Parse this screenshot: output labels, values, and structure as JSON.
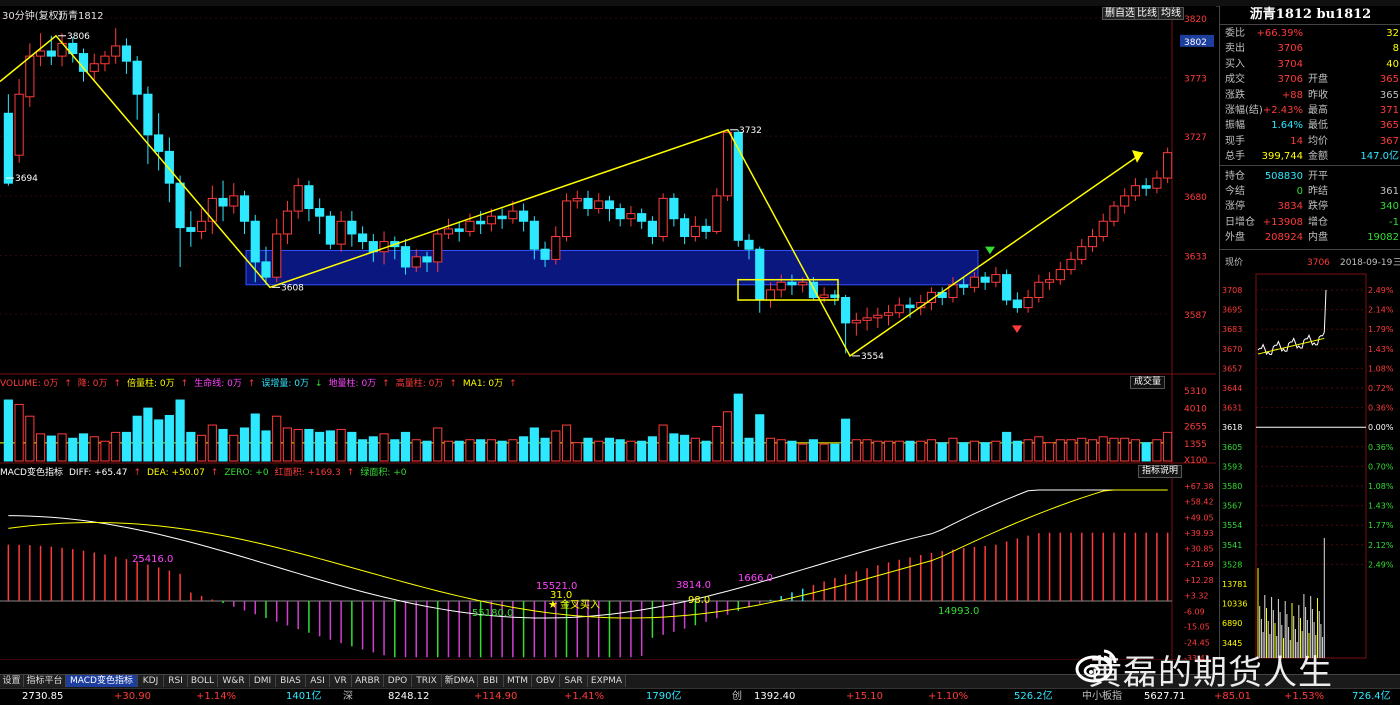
{
  "header": {
    "period": "30分钟(复权)",
    "symbol": "沥青1812",
    "buttons": [
      "删自选",
      "比线",
      "均线"
    ]
  },
  "chart_data": {
    "type": "candlestick",
    "price_axis_labels": [
      "3820",
      "3773",
      "3727",
      "3680",
      "3633",
      "3587"
    ],
    "current_price_tag": "3802",
    "candles": [
      [
        3745,
        3690,
        3760,
        3688
      ],
      [
        3712,
        3760,
        3772,
        3706
      ],
      [
        3758,
        3790,
        3800,
        3750
      ],
      [
        3790,
        3794,
        3808,
        3782
      ],
      [
        3794,
        3790,
        3806,
        3783
      ],
      [
        3790,
        3800,
        3808,
        3782
      ],
      [
        3800,
        3792,
        3805,
        3785
      ],
      [
        3792,
        3778,
        3796,
        3770
      ],
      [
        3778,
        3784,
        3792,
        3770
      ],
      [
        3784,
        3790,
        3794,
        3778
      ],
      [
        3790,
        3798,
        3812,
        3784
      ],
      [
        3798,
        3786,
        3804,
        3776
      ],
      [
        3786,
        3760,
        3790,
        3740
      ],
      [
        3760,
        3728,
        3766,
        3705
      ],
      [
        3728,
        3715,
        3745,
        3700
      ],
      [
        3715,
        3690,
        3726,
        3675
      ],
      [
        3690,
        3655,
        3696,
        3624
      ],
      [
        3655,
        3652,
        3668,
        3640
      ],
      [
        3652,
        3660,
        3670,
        3646
      ],
      [
        3660,
        3678,
        3688,
        3650
      ],
      [
        3678,
        3672,
        3692,
        3660
      ],
      [
        3672,
        3680,
        3690,
        3666
      ],
      [
        3680,
        3660,
        3684,
        3650
      ],
      [
        3660,
        3628,
        3665,
        3612
      ],
      [
        3628,
        3616,
        3640,
        3610
      ],
      [
        3616,
        3650,
        3662,
        3612
      ],
      [
        3650,
        3668,
        3676,
        3642
      ],
      [
        3668,
        3688,
        3694,
        3662
      ],
      [
        3688,
        3670,
        3692,
        3660
      ],
      [
        3670,
        3664,
        3678,
        3650
      ],
      [
        3664,
        3642,
        3668,
        3638
      ],
      [
        3642,
        3660,
        3668,
        3636
      ],
      [
        3660,
        3650,
        3668,
        3640
      ],
      [
        3650,
        3644,
        3656,
        3638
      ],
      [
        3644,
        3636,
        3650,
        3628
      ],
      [
        3636,
        3644,
        3652,
        3626
      ],
      [
        3644,
        3640,
        3648,
        3630
      ],
      [
        3640,
        3624,
        3646,
        3618
      ],
      [
        3624,
        3632,
        3638,
        3620
      ],
      [
        3632,
        3628,
        3636,
        3620
      ],
      [
        3628,
        3650,
        3654,
        3620
      ],
      [
        3650,
        3654,
        3662,
        3646
      ],
      [
        3654,
        3652,
        3660,
        3644
      ],
      [
        3652,
        3660,
        3666,
        3648
      ],
      [
        3660,
        3658,
        3668,
        3650
      ],
      [
        3658,
        3664,
        3670,
        3652
      ],
      [
        3664,
        3662,
        3670,
        3654
      ],
      [
        3662,
        3668,
        3676,
        3658
      ],
      [
        3668,
        3660,
        3674,
        3652
      ],
      [
        3660,
        3638,
        3664,
        3630
      ],
      [
        3638,
        3630,
        3644,
        3624
      ],
      [
        3630,
        3648,
        3656,
        3626
      ],
      [
        3648,
        3676,
        3682,
        3644
      ],
      [
        3676,
        3678,
        3684,
        3670
      ],
      [
        3678,
        3670,
        3684,
        3664
      ],
      [
        3670,
        3676,
        3682,
        3666
      ],
      [
        3676,
        3670,
        3680,
        3660
      ],
      [
        3670,
        3662,
        3674,
        3656
      ],
      [
        3662,
        3666,
        3672,
        3656
      ],
      [
        3666,
        3660,
        3670,
        3654
      ],
      [
        3660,
        3648,
        3664,
        3642
      ],
      [
        3648,
        3678,
        3682,
        3644
      ],
      [
        3678,
        3662,
        3682,
        3656
      ],
      [
        3662,
        3648,
        3666,
        3642
      ],
      [
        3648,
        3656,
        3664,
        3644
      ],
      [
        3656,
        3652,
        3662,
        3646
      ],
      [
        3652,
        3680,
        3686,
        3650
      ],
      [
        3680,
        3730,
        3732,
        3676
      ],
      [
        3730,
        3645,
        3732,
        3640
      ],
      [
        3645,
        3638,
        3650,
        3630
      ],
      [
        3638,
        3598,
        3640,
        3588
      ],
      [
        3598,
        3606,
        3612,
        3592
      ],
      [
        3606,
        3612,
        3618,
        3600
      ],
      [
        3612,
        3610,
        3618,
        3602
      ],
      [
        3610,
        3612,
        3616,
        3604
      ],
      [
        3612,
        3600,
        3616,
        3598
      ],
      [
        3600,
        3602,
        3608,
        3596
      ],
      [
        3602,
        3600,
        3606,
        3594
      ],
      [
        3600,
        3580,
        3602,
        3556
      ],
      [
        3580,
        3582,
        3588,
        3570
      ],
      [
        3582,
        3584,
        3592,
        3574
      ],
      [
        3584,
        3586,
        3592,
        3576
      ],
      [
        3586,
        3588,
        3594,
        3578
      ],
      [
        3588,
        3594,
        3600,
        3584
      ],
      [
        3594,
        3592,
        3600,
        3584
      ],
      [
        3592,
        3596,
        3602,
        3586
      ],
      [
        3596,
        3604,
        3608,
        3590
      ],
      [
        3604,
        3600,
        3608,
        3594
      ],
      [
        3600,
        3610,
        3616,
        3596
      ],
      [
        3610,
        3608,
        3616,
        3602
      ],
      [
        3608,
        3616,
        3620,
        3604
      ],
      [
        3616,
        3612,
        3620,
        3606
      ],
      [
        3612,
        3618,
        3624,
        3608
      ],
      [
        3618,
        3598,
        3622,
        3594
      ],
      [
        3598,
        3592,
        3604,
        3588
      ],
      [
        3592,
        3600,
        3606,
        3588
      ],
      [
        3600,
        3612,
        3618,
        3596
      ],
      [
        3612,
        3614,
        3620,
        3606
      ],
      [
        3614,
        3622,
        3628,
        3610
      ],
      [
        3622,
        3630,
        3636,
        3618
      ],
      [
        3630,
        3640,
        3646,
        3626
      ],
      [
        3640,
        3648,
        3654,
        3636
      ],
      [
        3648,
        3660,
        3666,
        3644
      ],
      [
        3660,
        3672,
        3676,
        3656
      ],
      [
        3672,
        3680,
        3686,
        3666
      ],
      [
        3680,
        3688,
        3694,
        3676
      ],
      [
        3688,
        3686,
        3694,
        3680
      ],
      [
        3686,
        3694,
        3700,
        3682
      ],
      [
        3694,
        3714,
        3718,
        3690
      ]
    ],
    "wave_points": [
      [
        "3806"
      ],
      [
        "3608"
      ],
      [
        "3732"
      ],
      [
        "3554"
      ]
    ],
    "extreme_labels": [
      "3806",
      "3694",
      "3608",
      "3732",
      "3554"
    ],
    "volume": {
      "axis_labels": [
        "5310",
        "4010",
        "2655",
        "1355",
        "X100"
      ],
      "tool_label": "成交量"
    },
    "macd": {
      "axis_labels": [
        "+67.38",
        "+58.42",
        "+49.05",
        "+39.93",
        "+30.85",
        "+21.69",
        "+12.28",
        "+3.32",
        "-6.09",
        "-15.05",
        "-24.45",
        "-33.41"
      ],
      "annotations": [
        "25416.0",
        "55180.0",
        "15521.0",
        "31.0",
        "98.0",
        "3814.0",
        "1666.0",
        "14993.0"
      ],
      "signal_text": "金叉买入",
      "tool_label": "指标说明"
    },
    "time_labels": [
      "15",
      "18-09-10 21:30",
      "15:00",
      "15:00",
      "15:00",
      "15:00",
      "15:00",
      "15:00"
    ]
  },
  "legends": {
    "volume": [
      {
        "text": "VOLUME: 0万",
        "color": "#ff3b3b"
      },
      {
        "text": "↑",
        "color": "#ff3b3b"
      },
      {
        "text": "降: 0万",
        "color": "#ff3b3b"
      },
      {
        "text": "↑",
        "color": "#ff3b3b"
      },
      {
        "text": "倍量柱: 0万",
        "color": "#ffff00"
      },
      {
        "text": "↑",
        "color": "#ff3b3b"
      },
      {
        "text": "生命线: 0万",
        "color": "#ff44ff"
      },
      {
        "text": "↑",
        "color": "#ff3b3b"
      },
      {
        "text": "误增量: 0万",
        "color": "#2ee8ff"
      },
      {
        "text": "↓",
        "color": "#33dd33"
      },
      {
        "text": "地量柱: 0万",
        "color": "#ff44ff"
      },
      {
        "text": "↑",
        "color": "#ff3b3b"
      },
      {
        "text": "高量柱: 0万",
        "color": "#ff3b3b"
      },
      {
        "text": "↑",
        "color": "#ff3b3b"
      },
      {
        "text": "MA1: 0万",
        "color": "#ffff00"
      },
      {
        "text": "↑",
        "color": "#ff3b3b"
      }
    ],
    "macd": [
      {
        "text": "MACD变色指标",
        "color": "#ffffff"
      },
      {
        "text": "DIFF: +65.47",
        "color": "#ffffff"
      },
      {
        "text": "↑",
        "color": "#ff3b3b"
      },
      {
        "text": "DEA: +50.07",
        "color": "#ffff00"
      },
      {
        "text": "↑",
        "color": "#ff3b3b"
      },
      {
        "text": "ZERO: +0",
        "color": "#33dd33"
      },
      {
        "text": "红面积: +169.3",
        "color": "#ff3b3b"
      },
      {
        "text": "↑",
        "color": "#ff3b3b"
      },
      {
        "text": "绿面积: +0",
        "color": "#33dd33"
      }
    ]
  },
  "quote_panel": {
    "title": "沥青1812 bu1812",
    "rows": [
      {
        "l1": "委比",
        "v1": "+66.39%",
        "c1": "#ff3b3b",
        "l2": "",
        "v2": "32",
        "c2": "#ffff00"
      },
      {
        "l1": "卖出",
        "v1": "3706",
        "c1": "#ff3b3b",
        "l2": "",
        "v2": "8",
        "c2": "#ffff00"
      },
      {
        "l1": "买入",
        "v1": "3704",
        "c1": "#ff3b3b",
        "l2": "",
        "v2": "40",
        "c2": "#ffff00"
      },
      {
        "l1": "成交",
        "v1": "3706",
        "c1": "#ff3b3b",
        "l2": "开盘",
        "v2": "365",
        "c2": "#ff3b3b"
      },
      {
        "l1": "涨跌",
        "v1": "+88",
        "c1": "#ff3b3b",
        "l2": "昨收",
        "v2": "365",
        "c2": "#c0c0c0"
      },
      {
        "l1": "涨幅(结)",
        "v1": "+2.43%",
        "c1": "#ff3b3b",
        "l2": "最高",
        "v2": "371",
        "c2": "#ff3b3b"
      },
      {
        "l1": "振幅",
        "v1": "1.64%",
        "c1": "#2ee8ff",
        "l2": "最低",
        "v2": "365",
        "c2": "#ff3b3b"
      },
      {
        "l1": "现手",
        "v1": "14",
        "c1": "#ff3b3b",
        "l2": "均价",
        "v2": "367",
        "c2": "#ff3b3b"
      },
      {
        "l1": "总手",
        "v1": "399,744",
        "c1": "#ffff00",
        "l2": "金额",
        "v2": "147.0亿",
        "c2": "#2ee8ff"
      },
      {
        "l1": "持仓",
        "v1": "508830",
        "c1": "#2ee8ff",
        "l2": "开平",
        "v2": "",
        "c2": "#c0c0c0"
      },
      {
        "l1": "今结",
        "v1": "0",
        "c1": "#33dd33",
        "l2": "昨结",
        "v2": "361",
        "c2": "#c0c0c0"
      },
      {
        "l1": "涨停",
        "v1": "3834",
        "c1": "#ff3b3b",
        "l2": "跌停",
        "v2": "340",
        "c2": "#33dd33"
      },
      {
        "l1": "日增仓",
        "v1": "+13908",
        "c1": "#ff3b3b",
        "l2": "增仓",
        "v2": "-1",
        "c2": "#33dd33"
      },
      {
        "l1": "外盘",
        "v1": "208924",
        "c1": "#ff3b3b",
        "l2": "内盘",
        "v2": "19082",
        "c2": "#33dd33"
      }
    ],
    "mini_header": {
      "label": "现价",
      "price": "3706",
      "date": "2018-09-19",
      "suffix": "三"
    },
    "mini_left_axis": [
      "3708",
      "3695",
      "3683",
      "3670",
      "3657",
      "3644",
      "3631",
      "3618",
      "3605",
      "3593",
      "3580",
      "3567",
      "3554",
      "3541",
      "3528",
      "13781",
      "10336",
      "6890",
      "3445"
    ],
    "mini_right_axis": [
      "2.49%",
      "2.14%",
      "1.79%",
      "1.43%",
      "1.08%",
      "0.72%",
      "0.36%",
      "0.00%",
      "0.36%",
      "0.70%",
      "1.08%",
      "1.43%",
      "1.77%",
      "2.12%",
      "2.49%"
    ]
  },
  "tabs": [
    "设置",
    "指标平台",
    "MACD变色指标",
    "KDJ",
    "RSI",
    "BOLL",
    "W&R",
    "DMI",
    "BIAS",
    "ASI",
    "VR",
    "ARBR",
    "DPO",
    "TRIX",
    "新DMA",
    "BBI",
    "MTM",
    "OBV",
    "SAR",
    "EXPMA"
  ],
  "status": [
    {
      "text": "2730.85",
      "color": "#ffffff"
    },
    {
      "text": "+30.90",
      "color": "#ff3b3b"
    },
    {
      "text": "+1.14%",
      "color": "#ff3b3b"
    },
    {
      "text": "1401亿",
      "color": "#2ee8ff"
    },
    {
      "text": "深",
      "color": "#c0c0c0"
    },
    {
      "text": "8248.12",
      "color": "#ffffff"
    },
    {
      "text": "+114.90",
      "color": "#ff3b3b"
    },
    {
      "text": "+1.41%",
      "color": "#ff3b3b"
    },
    {
      "text": "1790亿",
      "color": "#2ee8ff"
    },
    {
      "text": "创",
      "color": "#c0c0c0"
    },
    {
      "text": "1392.40",
      "color": "#ffffff"
    },
    {
      "text": "+15.10",
      "color": "#ff3b3b"
    },
    {
      "text": "+1.10%",
      "color": "#ff3b3b"
    },
    {
      "text": "526.2亿",
      "color": "#2ee8ff"
    },
    {
      "text": "中小板指",
      "color": "#c0c0c0"
    },
    {
      "text": "5627.71",
      "color": "#ffffff"
    },
    {
      "text": "+85.01",
      "color": "#ff3b3b"
    },
    {
      "text": "+1.53%",
      "color": "#ff3b3b"
    },
    {
      "text": "726.4亿",
      "color": "#2ee8ff"
    }
  ],
  "watermark": "黄磊的期货人生"
}
